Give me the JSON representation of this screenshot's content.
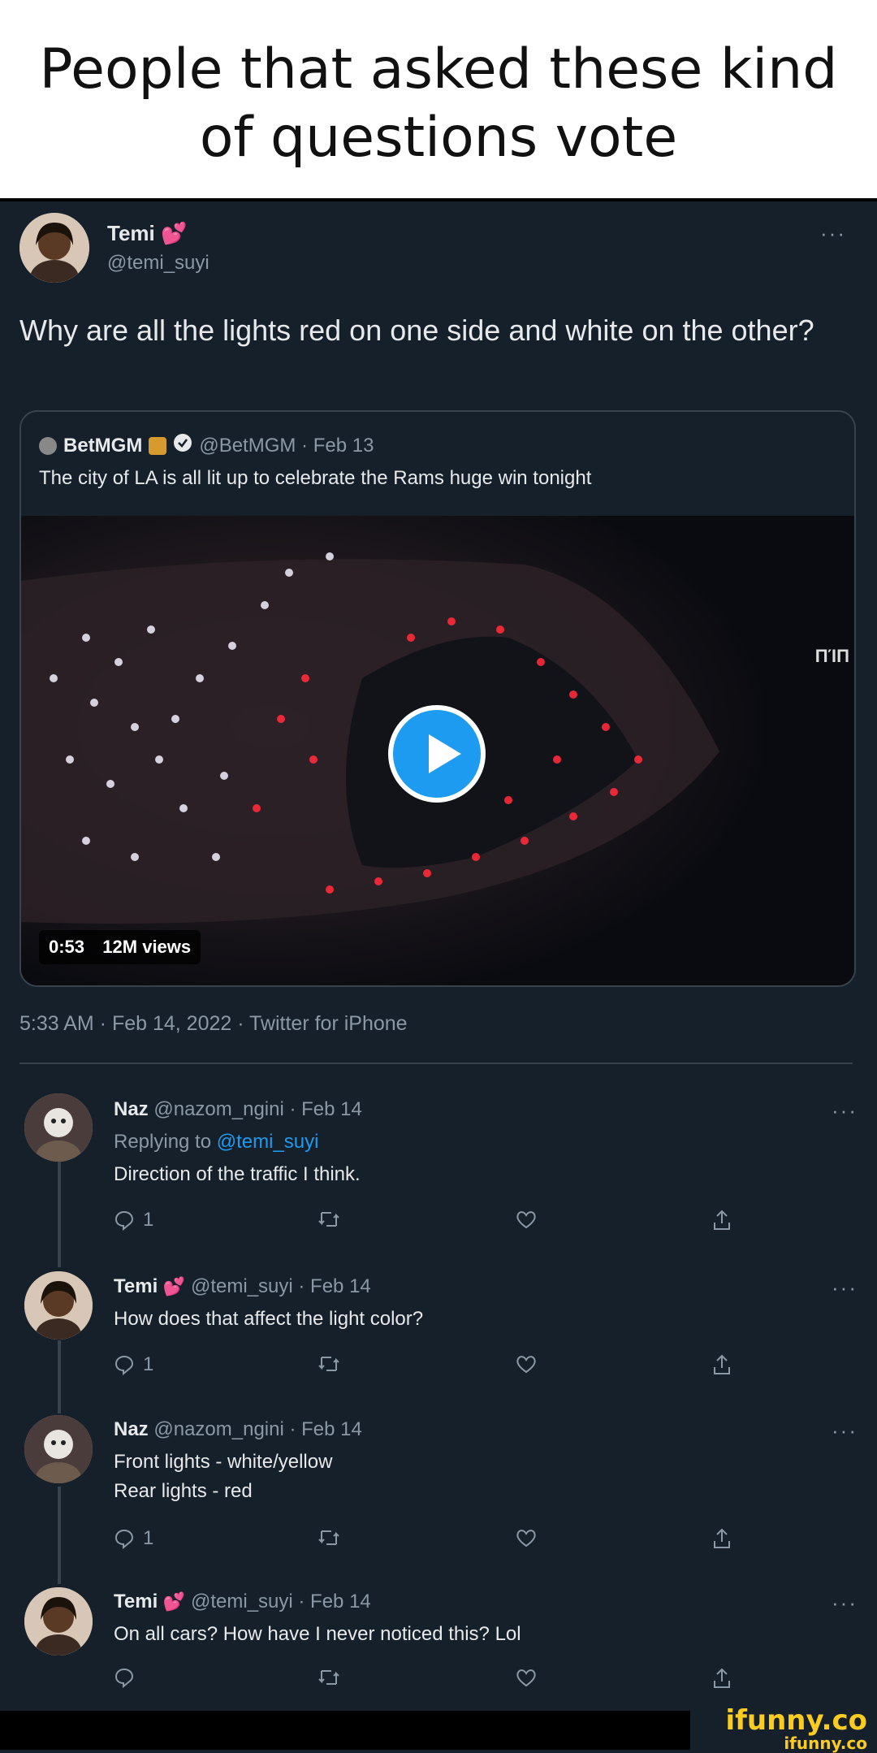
{
  "caption": {
    "text": "People that asked these kind of questions vote"
  },
  "main_tweet": {
    "author_name": "Temi",
    "handle": "@temi_suyi",
    "text": "Why are all the lights red on one side and white on the other?",
    "meta": "5:33 AM · Feb 14, 2022 · Twitter for iPhone",
    "more": "···"
  },
  "quote_tweet": {
    "author_name": "BetMGM",
    "handle_date": "@BetMGM · Feb 13",
    "text": "The city of LA is all lit up to celebrate the Rams huge win tonight",
    "video_duration": "0:53",
    "video_views": "12M views",
    "overlay_sign": "ΠΊΠ"
  },
  "replies": [
    {
      "author_name": "Naz",
      "handle_date": "@nazom_ngini · Feb 14",
      "replying_to_label": "Replying to",
      "replying_to_handle": "@temi_suyi",
      "lines": [
        "Direction of the traffic I think."
      ],
      "reply_count": "1"
    },
    {
      "author_name": "Temi",
      "handle_date": "@temi_suyi · Feb 14",
      "lines": [
        "How does that affect the light color?"
      ],
      "reply_count": "1"
    },
    {
      "author_name": "Naz",
      "handle_date": "@nazom_ngini · Feb 14",
      "lines": [
        "Front lights - white/yellow",
        "Rear lights - red"
      ],
      "reply_count": "1"
    },
    {
      "author_name": "Temi",
      "handle_date": "@temi_suyi · Feb 14",
      "lines": [
        "On all cars? How have I never noticed this? Lol"
      ],
      "reply_count": ""
    }
  ],
  "watermark": {
    "primary": "ifunny.co",
    "secondary": "ifunny.co"
  },
  "colors": {
    "background": "#15202b",
    "link": "#1d9bf0",
    "muted": "#8b98a5",
    "heart": "#e0245e",
    "watermark": "#fbcc20"
  },
  "icons": [
    "more-icon",
    "verified-icon",
    "reply-icon",
    "retweet-icon",
    "like-icon",
    "share-icon",
    "play-icon"
  ]
}
